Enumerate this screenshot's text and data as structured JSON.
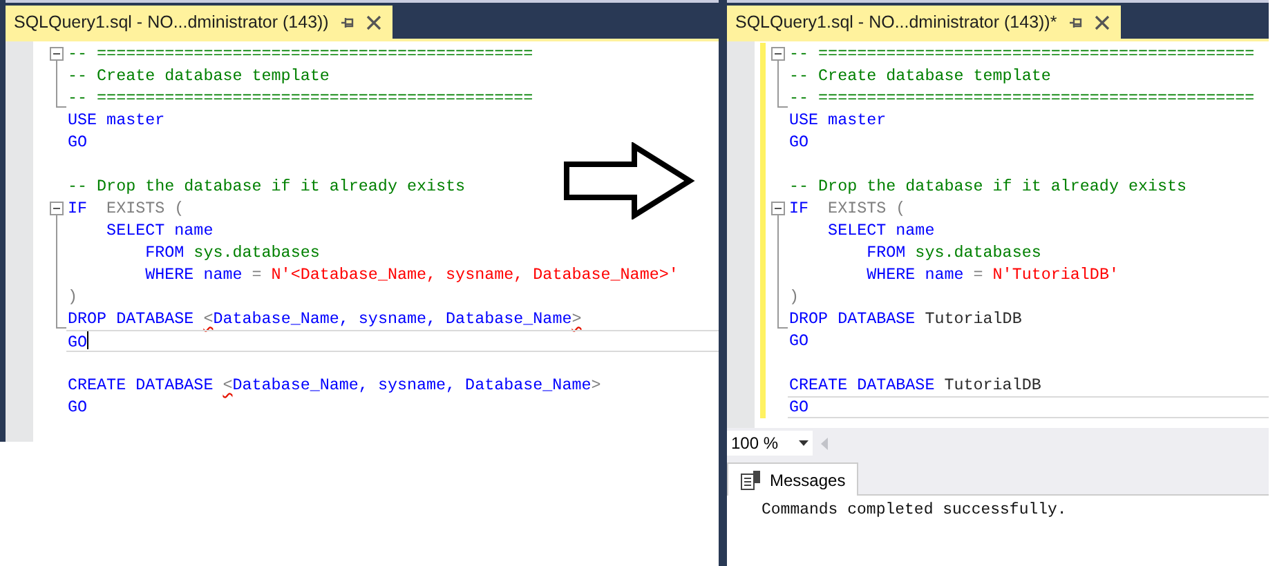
{
  "left_pane": {
    "tab": {
      "title": "SQLQuery1.sql - NO...dministrator (143))"
    },
    "caret": true,
    "lines": [
      {
        "kind": "fold-start",
        "current": false,
        "changed": false,
        "tokens": [
          {
            "text": "-- =============================================",
            "kind": "comment",
            "squiggle": false
          }
        ]
      },
      {
        "kind": "fold-body",
        "current": false,
        "changed": false,
        "tokens": [
          {
            "text": "-- Create database template",
            "kind": "comment",
            "squiggle": false
          }
        ]
      },
      {
        "kind": "fold-end",
        "current": false,
        "changed": false,
        "tokens": [
          {
            "text": "-- =============================================",
            "kind": "comment",
            "squiggle": false
          }
        ]
      },
      {
        "kind": "plain",
        "current": false,
        "changed": false,
        "tokens": [
          {
            "text": "USE master",
            "kind": "keyword",
            "squiggle": false
          }
        ]
      },
      {
        "kind": "plain",
        "current": false,
        "changed": false,
        "tokens": [
          {
            "text": "GO",
            "kind": "keyword",
            "squiggle": false
          }
        ]
      },
      {
        "kind": "plain",
        "current": false,
        "changed": false
      },
      {
        "kind": "plain",
        "current": false,
        "changed": false,
        "tokens": [
          {
            "text": "-- Drop the database if it already exists",
            "kind": "comment",
            "squiggle": false
          }
        ]
      },
      {
        "kind": "fold-start",
        "current": false,
        "changed": false,
        "tokens": [
          {
            "text": "IF",
            "kind": "keyword",
            "squiggle": false
          },
          {
            "text": "  EXISTS (",
            "kind": "operator",
            "squiggle": false
          }
        ]
      },
      {
        "kind": "fold-body",
        "current": false,
        "changed": false,
        "tokens": [
          {
            "text": "    SELECT name",
            "kind": "keyword",
            "squiggle": false
          }
        ]
      },
      {
        "kind": "fold-body",
        "current": false,
        "changed": false,
        "tokens": [
          {
            "text": "        FROM",
            "kind": "keyword",
            "squiggle": false
          },
          {
            "text": " sys.databases",
            "kind": "system",
            "squiggle": false
          }
        ]
      },
      {
        "kind": "fold-body",
        "current": false,
        "changed": false,
        "tokens": [
          {
            "text": "        WHERE name ",
            "kind": "keyword",
            "squiggle": false
          },
          {
            "text": "= ",
            "kind": "operator",
            "squiggle": false
          },
          {
            "text": "N'<Database_Name, sysname, Database_Name>'",
            "kind": "string",
            "squiggle": false
          }
        ]
      },
      {
        "kind": "fold-body",
        "current": false,
        "changed": false,
        "tokens": [
          {
            "text": ")",
            "kind": "operator",
            "squiggle": false
          }
        ]
      },
      {
        "kind": "fold-end",
        "current": false,
        "changed": false,
        "tokens": [
          {
            "text": "DROP DATABASE ",
            "kind": "keyword",
            "squiggle": false
          },
          {
            "text": "<",
            "kind": "operator",
            "squiggle": true
          },
          {
            "text": "Database_Name, sysname, Database_Name",
            "kind": "keyword",
            "squiggle": false
          },
          {
            "text": ">",
            "kind": "operator",
            "squiggle": true
          }
        ]
      },
      {
        "kind": "plain",
        "current": true,
        "changed": false,
        "tokens": [
          {
            "text": "GO",
            "kind": "keyword",
            "squiggle": false
          }
        ]
      },
      {
        "kind": "plain",
        "current": false,
        "changed": false
      },
      {
        "kind": "plain",
        "current": false,
        "changed": false,
        "tokens": [
          {
            "text": "CREATE DATABASE ",
            "kind": "keyword",
            "squiggle": false
          },
          {
            "text": "<",
            "kind": "operator",
            "squiggle": true
          },
          {
            "text": "Database_Name, sysname, Database_Name",
            "kind": "keyword",
            "squiggle": false
          },
          {
            "text": ">",
            "kind": "operator",
            "squiggle": false
          }
        ]
      },
      {
        "kind": "plain",
        "current": false,
        "changed": false,
        "tokens": [
          {
            "text": "GO",
            "kind": "keyword",
            "squiggle": false
          }
        ]
      }
    ]
  },
  "right_pane": {
    "tab": {
      "title": "SQLQuery1.sql - NO...dministrator (143))*"
    },
    "lines": [
      {
        "kind": "fold-start",
        "current": false,
        "changed": true,
        "tokens": [
          {
            "text": "-- =============================================",
            "kind": "comment",
            "squiggle": false
          }
        ]
      },
      {
        "kind": "fold-body",
        "current": false,
        "changed": true,
        "tokens": [
          {
            "text": "-- Create database template",
            "kind": "comment",
            "squiggle": false
          }
        ]
      },
      {
        "kind": "fold-end",
        "current": false,
        "changed": true,
        "tokens": [
          {
            "text": "-- =============================================",
            "kind": "comment",
            "squiggle": false
          }
        ]
      },
      {
        "kind": "plain",
        "current": false,
        "changed": true,
        "tokens": [
          {
            "text": "USE master",
            "kind": "keyword",
            "squiggle": false
          }
        ]
      },
      {
        "kind": "plain",
        "current": false,
        "changed": true,
        "tokens": [
          {
            "text": "GO",
            "kind": "keyword",
            "squiggle": false
          }
        ]
      },
      {
        "kind": "plain",
        "current": false,
        "changed": true
      },
      {
        "kind": "plain",
        "current": false,
        "changed": true,
        "tokens": [
          {
            "text": "-- Drop the database if it already exists",
            "kind": "comment",
            "squiggle": false
          }
        ]
      },
      {
        "kind": "fold-start",
        "current": false,
        "changed": true,
        "tokens": [
          {
            "text": "IF",
            "kind": "keyword",
            "squiggle": false
          },
          {
            "text": "  EXISTS (",
            "kind": "operator",
            "squiggle": false
          }
        ]
      },
      {
        "kind": "fold-body",
        "current": false,
        "changed": true,
        "tokens": [
          {
            "text": "    SELECT name",
            "kind": "keyword",
            "squiggle": false
          }
        ]
      },
      {
        "kind": "fold-body",
        "current": false,
        "changed": true,
        "tokens": [
          {
            "text": "        FROM",
            "kind": "keyword",
            "squiggle": false
          },
          {
            "text": " sys.databases",
            "kind": "system",
            "squiggle": false
          }
        ]
      },
      {
        "kind": "fold-body",
        "current": false,
        "changed": true,
        "tokens": [
          {
            "text": "        WHERE name ",
            "kind": "keyword",
            "squiggle": false
          },
          {
            "text": "= ",
            "kind": "operator",
            "squiggle": false
          },
          {
            "text": "N'TutorialDB'",
            "kind": "string",
            "squiggle": false
          }
        ]
      },
      {
        "kind": "fold-body",
        "current": false,
        "changed": true,
        "tokens": [
          {
            "text": ")",
            "kind": "operator",
            "squiggle": false
          }
        ]
      },
      {
        "kind": "fold-end",
        "current": false,
        "changed": true,
        "tokens": [
          {
            "text": "DROP DATABASE ",
            "kind": "keyword",
            "squiggle": false
          },
          {
            "text": "TutorialDB",
            "kind": "plain",
            "squiggle": false
          }
        ]
      },
      {
        "kind": "plain",
        "current": false,
        "changed": true,
        "tokens": [
          {
            "text": "GO",
            "kind": "keyword",
            "squiggle": false
          }
        ]
      },
      {
        "kind": "plain",
        "current": false,
        "changed": true
      },
      {
        "kind": "plain",
        "current": false,
        "changed": true,
        "tokens": [
          {
            "text": "CREATE DATABASE ",
            "kind": "keyword",
            "squiggle": false
          },
          {
            "text": "TutorialDB",
            "kind": "plain",
            "squiggle": false
          }
        ]
      },
      {
        "kind": "plain",
        "current": true,
        "changed": true,
        "tokens": [
          {
            "text": "GO",
            "kind": "keyword",
            "squiggle": false
          }
        ]
      }
    ],
    "zoom": {
      "value": "100 %"
    },
    "results_tab": {
      "label": "Messages",
      "selected": true
    },
    "message": "Commands completed successfully."
  }
}
